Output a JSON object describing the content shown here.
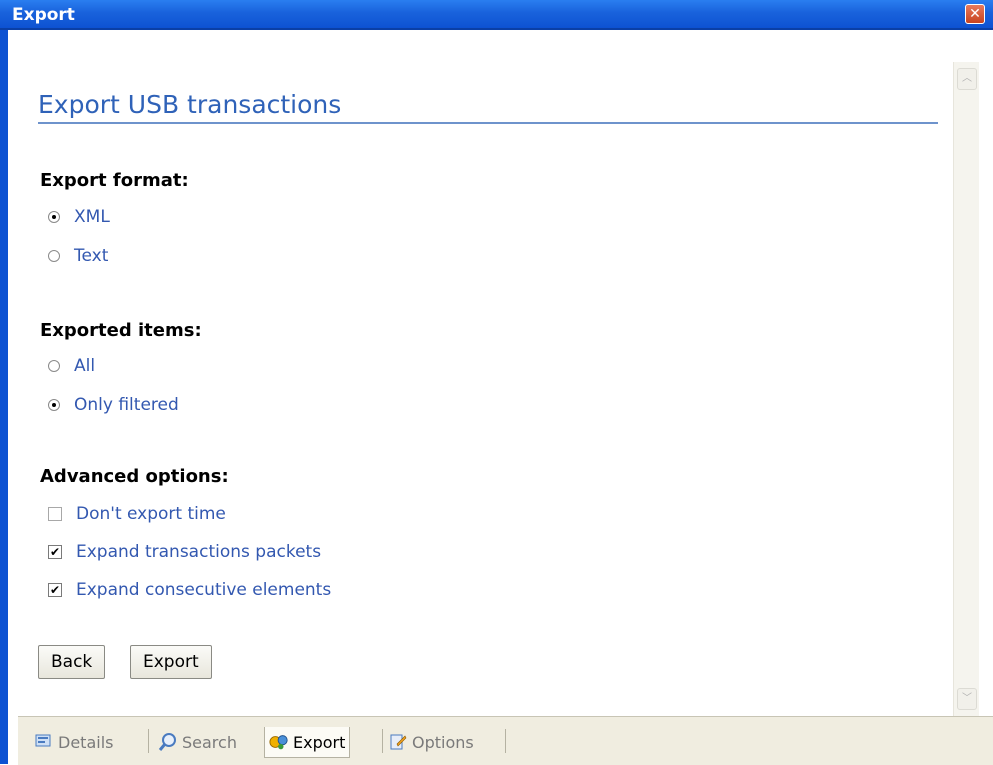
{
  "window": {
    "title": "Export",
    "close_glyph": "✕"
  },
  "page": {
    "title": "Export USB transactions"
  },
  "export_format": {
    "heading": "Export format:",
    "options": [
      {
        "label": "XML",
        "selected": true
      },
      {
        "label": "Text",
        "selected": false
      }
    ]
  },
  "exported_items": {
    "heading": "Exported items:",
    "options": [
      {
        "label": "All",
        "selected": false
      },
      {
        "label": "Only filtered",
        "selected": true
      }
    ]
  },
  "advanced_options": {
    "heading": "Advanced options:",
    "options": [
      {
        "label": "Don't export time",
        "checked": false
      },
      {
        "label": "Expand transactions packets",
        "checked": true
      },
      {
        "label": "Expand consecutive elements",
        "checked": true
      }
    ]
  },
  "buttons": {
    "back": "Back",
    "export": "Export"
  },
  "tabs": [
    {
      "label": "Details",
      "icon": "details-icon",
      "active": false
    },
    {
      "label": "Search",
      "icon": "search-icon",
      "active": false
    },
    {
      "label": "Export",
      "icon": "export-icon",
      "active": true
    },
    {
      "label": "Options",
      "icon": "options-icon",
      "active": false
    }
  ],
  "colors": {
    "titlebar": "#0d52d2",
    "link_text": "#3358b0",
    "heading_blue": "#2f62b8"
  }
}
